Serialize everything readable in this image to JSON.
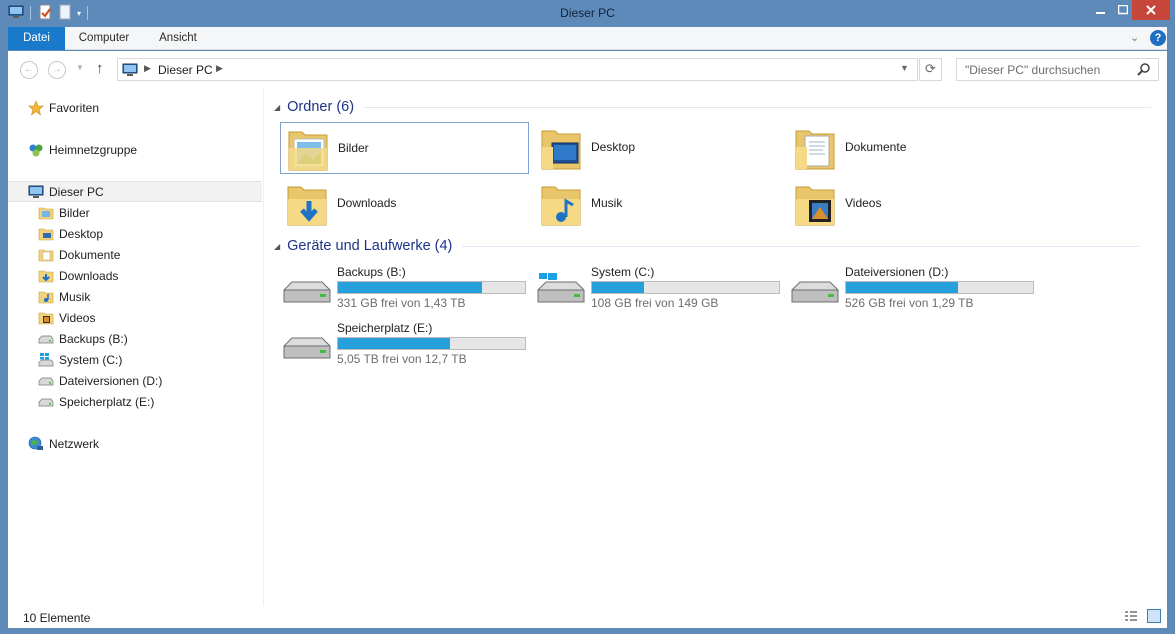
{
  "window": {
    "title": "Dieser PC"
  },
  "ribbon": {
    "tabs": [
      {
        "label": "Datei"
      },
      {
        "label": "Computer"
      },
      {
        "label": "Ansicht"
      }
    ]
  },
  "address": {
    "location": "Dieser PC",
    "search_placeholder": "\"Dieser PC\" durchsuchen"
  },
  "sidebar": {
    "favorites": "Favoriten",
    "homegroup": "Heimnetzgruppe",
    "this_pc": "Dieser PC",
    "items": [
      {
        "label": "Bilder",
        "icon": "pictures-folder-icon"
      },
      {
        "label": "Desktop",
        "icon": "desktop-folder-icon"
      },
      {
        "label": "Dokumente",
        "icon": "documents-folder-icon"
      },
      {
        "label": "Downloads",
        "icon": "downloads-folder-icon"
      },
      {
        "label": "Musik",
        "icon": "music-folder-icon"
      },
      {
        "label": "Videos",
        "icon": "videos-folder-icon"
      },
      {
        "label": "Backups (B:)",
        "icon": "drive-icon"
      },
      {
        "label": "System (C:)",
        "icon": "windows-drive-icon"
      },
      {
        "label": "Dateiversionen (D:)",
        "icon": "drive-icon"
      },
      {
        "label": "Speicherplatz (E:)",
        "icon": "drive-icon"
      }
    ],
    "network": "Netzwerk"
  },
  "main": {
    "folders_header": "Ordner (6)",
    "folders": [
      {
        "label": "Bilder"
      },
      {
        "label": "Desktop"
      },
      {
        "label": "Dokumente"
      },
      {
        "label": "Downloads"
      },
      {
        "label": "Musik"
      },
      {
        "label": "Videos"
      }
    ],
    "drives_header": "Geräte und Laufwerke (4)",
    "drives": [
      {
        "name": "Backups (B:)",
        "free": "331 GB frei von 1,43 TB",
        "used_fraction": 0.77
      },
      {
        "name": "System (C:)",
        "free": "108 GB frei von 149 GB",
        "used_fraction": 0.28
      },
      {
        "name": "Dateiversionen (D:)",
        "free": "526 GB frei von 1,29 TB",
        "used_fraction": 0.6
      },
      {
        "name": "Speicherplatz (E:)",
        "free": "5,05 TB frei von 12,7 TB",
        "used_fraction": 0.6
      }
    ]
  },
  "status": {
    "count": "10 Elemente"
  },
  "colors": {
    "accent": "#1979ca",
    "bar_fill": "#26a0da",
    "title_bar": "#5e8ab9",
    "group_title": "#1e3287"
  }
}
